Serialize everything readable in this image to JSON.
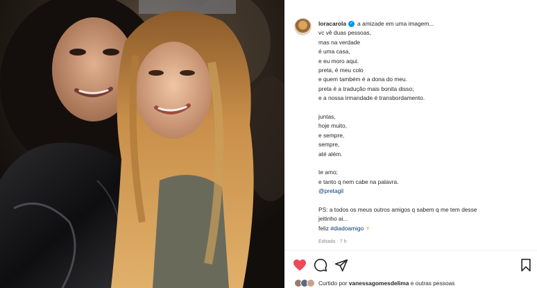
{
  "post": {
    "username": "loracarola",
    "verified_icon": "verified-badge-icon",
    "caption_first": "a amizade em uma imagem...",
    "caption_lines": [
      "vc vê duas pessoas,",
      "mas na verdade",
      "é uma casa,",
      "e eu moro aqui.",
      "preta, é meu colo",
      "e quem também é a dona do meu.",
      "preta é a tradução mais bonita disso;",
      "e a nossa irmandade é transbordamento.",
      "",
      "juntas,",
      "hoje muito,",
      "e sempre,",
      "sempre,",
      "até além.",
      "",
      "te amo;",
      "e tanto q nem cabe na palavra."
    ],
    "mention": "@pretagil",
    "ps_lines": [
      "PS: a todos os meus outros amigos q sabem q me tem desse",
      "jeitinho ai..."
    ],
    "feliz_text": "feliz",
    "hashtag": "#diadoamigo",
    "meta": "Editado · 7 h"
  },
  "actions": {
    "like_icon": "heart-filled-icon",
    "comment_icon": "comment-icon",
    "share_icon": "share-icon",
    "save_icon": "bookmark-icon",
    "like_color": "#ed4956"
  },
  "likes": {
    "prefix": "Curtido por",
    "user": "vanessagomesdelima",
    "suffix": "e outras pessoas"
  },
  "colors": {
    "link": "#00376b",
    "meta": "#8e8e8e",
    "verified": "#0095f6",
    "text": "#262626"
  }
}
